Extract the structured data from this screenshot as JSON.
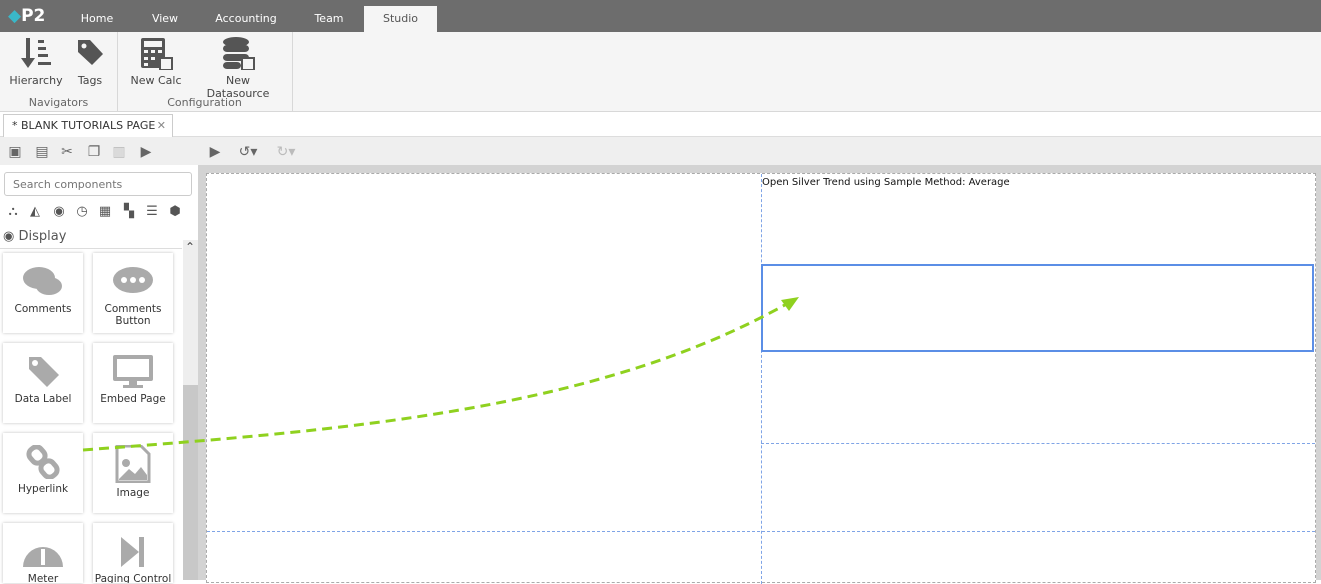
{
  "app": {
    "logo": "P2",
    "tabs": [
      "Home",
      "View",
      "Accounting",
      "Team",
      "Studio"
    ],
    "active_tab": "Studio"
  },
  "ribbon": {
    "buttons": {
      "hierarchy": "Hierarchy",
      "tags": "Tags",
      "new_calc": "New Calc",
      "new_datasource": "New Datasource"
    },
    "groups": {
      "navigators": "Navigators",
      "configuration": "Configuration"
    }
  },
  "document_tab": {
    "label": "* BLANK TUTORIALS PAGE",
    "close": "✕"
  },
  "left_panel": {
    "search_placeholder": "Search components",
    "section": "Display",
    "components": [
      "Comments",
      "Comments Button",
      "Data Label",
      "Embed Page",
      "Hyperlink",
      "Image",
      "Meter",
      "Paging Control"
    ]
  },
  "canvas": {
    "label": "Open Silver Trend using Sample Method: Average"
  },
  "colors": {
    "accent": "#5b8ee6",
    "arrow": "#8fd11f",
    "topbar": "#6d6d6d"
  }
}
